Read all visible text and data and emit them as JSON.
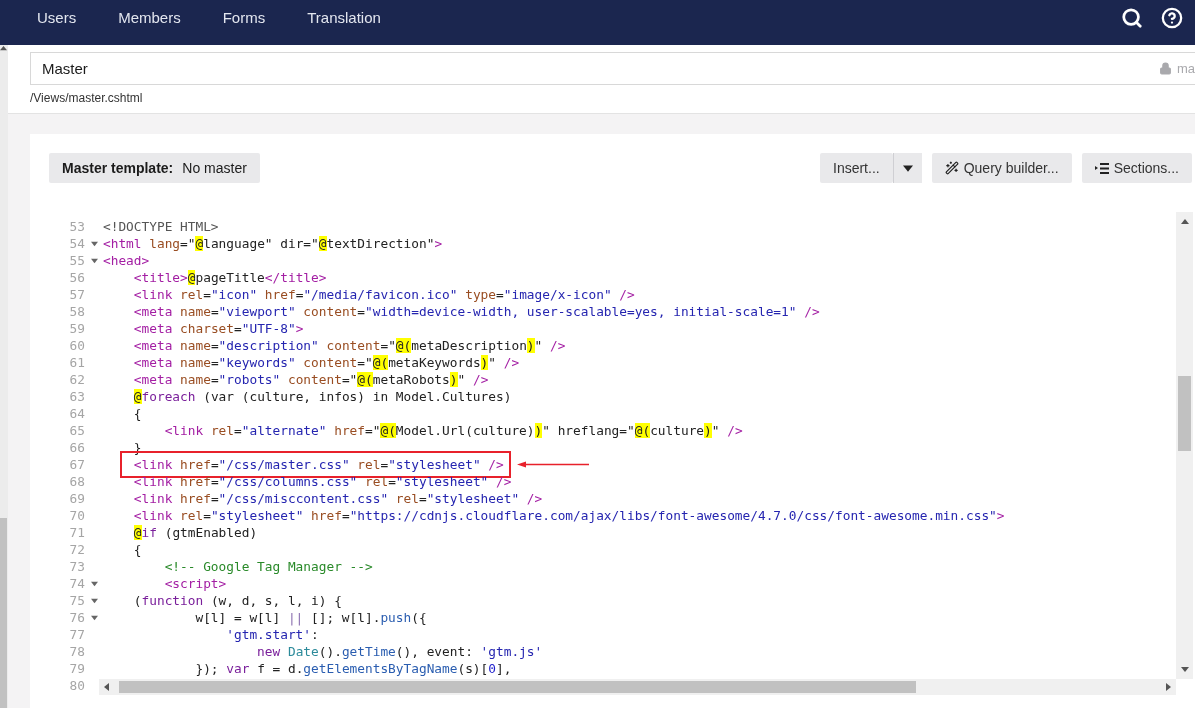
{
  "nav": {
    "items": [
      "Users",
      "Members",
      "Forms",
      "Translation"
    ]
  },
  "template": {
    "name": "Master",
    "alias": "ma",
    "path": "/Views/master.cshtml"
  },
  "toolbar": {
    "master_label": "Master template:",
    "master_value": "No master",
    "buttons": [
      {
        "kind": "split",
        "label": "Insert..."
      },
      {
        "kind": "wand",
        "label": "Query builder..."
      },
      {
        "kind": "sections",
        "label": "Sections..."
      }
    ]
  },
  "editor": {
    "lines": [
      {
        "n": "53",
        "fold": false,
        "annotated": false,
        "tokens": [
          {
            "kind": "meta",
            "text": "<!DOCTYPE HTML>"
          }
        ]
      },
      {
        "n": "54",
        "fold": true,
        "annotated": false,
        "tokens": [
          {
            "kind": "tag",
            "text": "<html "
          },
          {
            "kind": "attr",
            "text": "lang"
          },
          {
            "kind": "txt",
            "text": "=\""
          },
          {
            "kind": "hl",
            "text": "@"
          },
          {
            "kind": "txt",
            "text": "language\" dir=\""
          },
          {
            "kind": "hl",
            "text": "@"
          },
          {
            "kind": "txt",
            "text": "textDirection\""
          },
          {
            "kind": "tag",
            "text": ">"
          }
        ]
      },
      {
        "n": "55",
        "fold": true,
        "annotated": false,
        "tokens": [
          {
            "kind": "tag",
            "text": "<head>"
          }
        ]
      },
      {
        "n": "56",
        "fold": false,
        "annotated": false,
        "tokens": [
          {
            "kind": "tag",
            "text": "    <title>"
          },
          {
            "kind": "hl",
            "text": "@"
          },
          {
            "kind": "txt",
            "text": "pageTitle"
          },
          {
            "kind": "tag",
            "text": "</title>"
          }
        ]
      },
      {
        "n": "57",
        "fold": false,
        "annotated": false,
        "tokens": [
          {
            "kind": "tag",
            "text": "    <link "
          },
          {
            "kind": "attr",
            "text": "rel"
          },
          {
            "kind": "txt",
            "text": "="
          },
          {
            "kind": "str",
            "text": "\"icon\" "
          },
          {
            "kind": "attr",
            "text": "href"
          },
          {
            "kind": "txt",
            "text": "="
          },
          {
            "kind": "str",
            "text": "\"/media/favicon.ico\" "
          },
          {
            "kind": "attr",
            "text": "type"
          },
          {
            "kind": "txt",
            "text": "="
          },
          {
            "kind": "str",
            "text": "\"image/x-icon\" "
          },
          {
            "kind": "tag",
            "text": "/>"
          }
        ]
      },
      {
        "n": "58",
        "fold": false,
        "annotated": false,
        "tokens": [
          {
            "kind": "tag",
            "text": "    <meta "
          },
          {
            "kind": "attr",
            "text": "name"
          },
          {
            "kind": "txt",
            "text": "="
          },
          {
            "kind": "str",
            "text": "\"viewport\" "
          },
          {
            "kind": "attr",
            "text": "content"
          },
          {
            "kind": "txt",
            "text": "="
          },
          {
            "kind": "str",
            "text": "\"width=device-width, user-scalable=yes, initial-scale=1\" "
          },
          {
            "kind": "tag",
            "text": "/>"
          }
        ]
      },
      {
        "n": "59",
        "fold": false,
        "annotated": false,
        "tokens": [
          {
            "kind": "tag",
            "text": "    <meta "
          },
          {
            "kind": "attr",
            "text": "charset"
          },
          {
            "kind": "txt",
            "text": "="
          },
          {
            "kind": "str",
            "text": "\"UTF-8\""
          },
          {
            "kind": "tag",
            "text": ">"
          }
        ]
      },
      {
        "n": "60",
        "fold": false,
        "annotated": false,
        "tokens": [
          {
            "kind": "tag",
            "text": "    <meta "
          },
          {
            "kind": "attr",
            "text": "name"
          },
          {
            "kind": "txt",
            "text": "="
          },
          {
            "kind": "str",
            "text": "\"description\" "
          },
          {
            "kind": "attr",
            "text": "content"
          },
          {
            "kind": "txt",
            "text": "=\""
          },
          {
            "kind": "hl",
            "text": "@("
          },
          {
            "kind": "txt",
            "text": "metaDescription"
          },
          {
            "kind": "hl",
            "text": ")"
          },
          {
            "kind": "txt",
            "text": "\" "
          },
          {
            "kind": "tag",
            "text": "/>"
          }
        ]
      },
      {
        "n": "61",
        "fold": false,
        "annotated": false,
        "tokens": [
          {
            "kind": "tag",
            "text": "    <meta "
          },
          {
            "kind": "attr",
            "text": "name"
          },
          {
            "kind": "txt",
            "text": "="
          },
          {
            "kind": "str",
            "text": "\"keywords\" "
          },
          {
            "kind": "attr",
            "text": "content"
          },
          {
            "kind": "txt",
            "text": "=\""
          },
          {
            "kind": "hl",
            "text": "@("
          },
          {
            "kind": "txt",
            "text": "metaKeywords"
          },
          {
            "kind": "hl",
            "text": ")"
          },
          {
            "kind": "txt",
            "text": "\" "
          },
          {
            "kind": "tag",
            "text": "/>"
          }
        ]
      },
      {
        "n": "62",
        "fold": false,
        "annotated": false,
        "tokens": [
          {
            "kind": "tag",
            "text": "    <meta "
          },
          {
            "kind": "attr",
            "text": "name"
          },
          {
            "kind": "txt",
            "text": "="
          },
          {
            "kind": "str",
            "text": "\"robots\" "
          },
          {
            "kind": "attr",
            "text": "content"
          },
          {
            "kind": "txt",
            "text": "=\""
          },
          {
            "kind": "hl",
            "text": "@("
          },
          {
            "kind": "txt",
            "text": "metaRobots"
          },
          {
            "kind": "hl",
            "text": ")"
          },
          {
            "kind": "txt",
            "text": "\" "
          },
          {
            "kind": "tag",
            "text": "/>"
          }
        ]
      },
      {
        "n": "63",
        "fold": false,
        "annotated": false,
        "tokens": [
          {
            "kind": "hl",
            "text": "    @"
          },
          {
            "kind": "kw",
            "text": "foreach"
          },
          {
            "kind": "txt",
            "text": " (var (culture, infos) in Model.Cultures)"
          }
        ]
      },
      {
        "n": "64",
        "fold": false,
        "annotated": false,
        "tokens": [
          {
            "kind": "txt",
            "text": "    {"
          }
        ]
      },
      {
        "n": "65",
        "fold": false,
        "annotated": false,
        "tokens": [
          {
            "kind": "tag",
            "text": "        <link "
          },
          {
            "kind": "attr",
            "text": "rel"
          },
          {
            "kind": "txt",
            "text": "="
          },
          {
            "kind": "str",
            "text": "\"alternate\" "
          },
          {
            "kind": "attr",
            "text": "href"
          },
          {
            "kind": "txt",
            "text": "=\""
          },
          {
            "kind": "hl",
            "text": "@("
          },
          {
            "kind": "txt",
            "text": "Model.Url(culture)"
          },
          {
            "kind": "hl",
            "text": ")"
          },
          {
            "kind": "txt",
            "text": "\" hreflang=\""
          },
          {
            "kind": "hl",
            "text": "@("
          },
          {
            "kind": "txt",
            "text": "culture"
          },
          {
            "kind": "hl",
            "text": ")"
          },
          {
            "kind": "txt",
            "text": "\" "
          },
          {
            "kind": "tag",
            "text": "/>"
          }
        ]
      },
      {
        "n": "66",
        "fold": false,
        "annotated": false,
        "tokens": [
          {
            "kind": "txt",
            "text": "    }"
          }
        ]
      },
      {
        "n": "67",
        "fold": false,
        "annotated": true,
        "tokens": [
          {
            "kind": "tag",
            "text": "    <link "
          },
          {
            "kind": "attr",
            "text": "href"
          },
          {
            "kind": "txt",
            "text": "="
          },
          {
            "kind": "str",
            "text": "\"/css/master.css\" "
          },
          {
            "kind": "attr",
            "text": "rel"
          },
          {
            "kind": "txt",
            "text": "="
          },
          {
            "kind": "str",
            "text": "\"stylesheet\" "
          },
          {
            "kind": "tag",
            "text": "/>"
          }
        ]
      },
      {
        "n": "68",
        "fold": false,
        "annotated": false,
        "tokens": [
          {
            "kind": "tag",
            "text": "    <link "
          },
          {
            "kind": "attr",
            "text": "href"
          },
          {
            "kind": "txt",
            "text": "="
          },
          {
            "kind": "str",
            "text": "\"/css/columns.css\" "
          },
          {
            "kind": "attr",
            "text": "rel"
          },
          {
            "kind": "txt",
            "text": "="
          },
          {
            "kind": "str",
            "text": "\"stylesheet\" "
          },
          {
            "kind": "tag",
            "text": "/>"
          }
        ]
      },
      {
        "n": "69",
        "fold": false,
        "annotated": false,
        "tokens": [
          {
            "kind": "tag",
            "text": "    <link "
          },
          {
            "kind": "attr",
            "text": "href"
          },
          {
            "kind": "txt",
            "text": "="
          },
          {
            "kind": "str",
            "text": "\"/css/misccontent.css\" "
          },
          {
            "kind": "attr",
            "text": "rel"
          },
          {
            "kind": "txt",
            "text": "="
          },
          {
            "kind": "str",
            "text": "\"stylesheet\" "
          },
          {
            "kind": "tag",
            "text": "/>"
          }
        ]
      },
      {
        "n": "70",
        "fold": false,
        "annotated": false,
        "tokens": [
          {
            "kind": "tag",
            "text": "    <link "
          },
          {
            "kind": "attr",
            "text": "rel"
          },
          {
            "kind": "txt",
            "text": "="
          },
          {
            "kind": "str",
            "text": "\"stylesheet\" "
          },
          {
            "kind": "attr",
            "text": "href"
          },
          {
            "kind": "txt",
            "text": "="
          },
          {
            "kind": "str",
            "text": "\"https://cdnjs.cloudflare.com/ajax/libs/font-awesome/4.7.0/css/font-awesome.min.css\""
          },
          {
            "kind": "tag",
            "text": ">"
          }
        ]
      },
      {
        "n": "71",
        "fold": false,
        "annotated": false,
        "tokens": [
          {
            "kind": "hl",
            "text": "    @"
          },
          {
            "kind": "kw",
            "text": "if"
          },
          {
            "kind": "txt",
            "text": " (gtmEnabled)"
          }
        ]
      },
      {
        "n": "72",
        "fold": false,
        "annotated": false,
        "tokens": [
          {
            "kind": "txt",
            "text": "    {"
          }
        ]
      },
      {
        "n": "73",
        "fold": false,
        "annotated": false,
        "tokens": [
          {
            "kind": "com",
            "text": "        <!-- Google Tag Manager -->"
          }
        ]
      },
      {
        "n": "74",
        "fold": true,
        "annotated": false,
        "tokens": [
          {
            "kind": "tag",
            "text": "        <script>"
          }
        ]
      },
      {
        "n": "75",
        "fold": true,
        "annotated": false,
        "tokens": [
          {
            "kind": "txt",
            "text": "    ("
          },
          {
            "kind": "kw",
            "text": "function"
          },
          {
            "kind": "txt",
            "text": " (w, d, s, l, i) {"
          }
        ]
      },
      {
        "n": "76",
        "fold": true,
        "annotated": false,
        "tokens": [
          {
            "kind": "txt",
            "text": "            w[l] = w[l] "
          },
          {
            "kind": "op",
            "text": "||"
          },
          {
            "kind": "txt",
            "text": " []; w[l]."
          },
          {
            "kind": "fn",
            "text": "push"
          },
          {
            "kind": "txt",
            "text": "({"
          }
        ]
      },
      {
        "n": "77",
        "fold": false,
        "annotated": false,
        "tokens": [
          {
            "kind": "str",
            "text": "                'gtm.start'"
          },
          {
            "kind": "txt",
            "text": ":"
          }
        ]
      },
      {
        "n": "78",
        "fold": false,
        "annotated": false,
        "tokens": [
          {
            "kind": "kw",
            "text": "                    new "
          },
          {
            "kind": "ty",
            "text": "Date"
          },
          {
            "kind": "txt",
            "text": "()."
          },
          {
            "kind": "fn",
            "text": "getTime"
          },
          {
            "kind": "txt",
            "text": "(), event: "
          },
          {
            "kind": "str",
            "text": "'gtm.js'"
          }
        ]
      },
      {
        "n": "79",
        "fold": false,
        "annotated": false,
        "tokens": [
          {
            "kind": "txt",
            "text": "            }); "
          },
          {
            "kind": "kw",
            "text": "var"
          },
          {
            "kind": "txt",
            "text": " f = d."
          },
          {
            "kind": "fn",
            "text": "getElementsByTagName"
          },
          {
            "kind": "txt",
            "text": "(s)["
          },
          {
            "kind": "num",
            "text": "0"
          },
          {
            "kind": "txt",
            "text": "],"
          }
        ]
      },
      {
        "n": "80",
        "fold": false,
        "annotated": false
      }
    ]
  }
}
